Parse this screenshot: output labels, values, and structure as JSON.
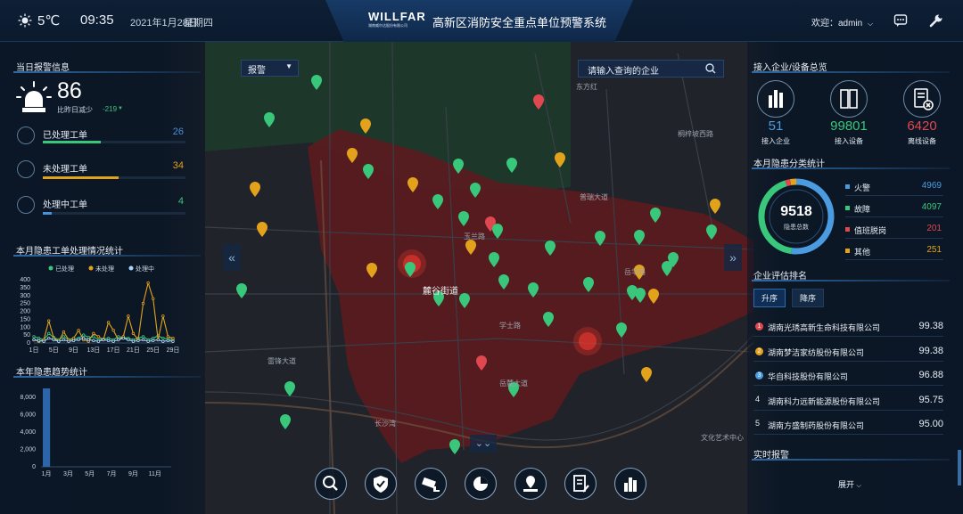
{
  "header": {
    "temperature": "5℃",
    "time": "09:35",
    "date": "2021年1月28日",
    "weekday": "星期四",
    "logo_text": "WILLFAR",
    "logo_subtext": "湖南威尔达股份有限公司",
    "title": "高新区消防安全重点单位预警系统",
    "welcome": "欢迎：admin",
    "icons": [
      "sun-icon",
      "chevron-down-icon",
      "message-icon",
      "wrench-icon"
    ]
  },
  "left": {
    "alarm_title": "当日报警信息",
    "alarm_count": "86",
    "alarm_compare_label": "比昨日减少",
    "alarm_compare_value": "-219",
    "orders": [
      {
        "label": "已处理工单",
        "value": "26",
        "color": "#4a90d9",
        "fill": 0.76
      },
      {
        "label": "未处理工单",
        "value": "34",
        "color": "#e3a21c",
        "fill": 0.58
      },
      {
        "label": "处理中工单",
        "value": "4",
        "color": "#38c77b",
        "fill": 0.05
      }
    ],
    "monthly_title": "本月隐患工单处理情况统计",
    "yearly_title": "本年隐患趋势统计"
  },
  "map": {
    "select_label": "报警",
    "search_placeholder": "请输入查询的企业",
    "district_label": "麓谷街道",
    "place_labels": [
      "雷锋大道",
      "东方红",
      "普瑞大道",
      "长沙湾",
      "岳麓大道",
      "文化艺术中心",
      "桐梓坡西路",
      "玉兰路",
      "学士路",
      "岳华路"
    ]
  },
  "right": {
    "overview_title": "接入企业/设备总览",
    "kpis": [
      {
        "value": "51",
        "label": "接入企业",
        "color": "#4a9be0",
        "icon": "enterprise-building-icon"
      },
      {
        "value": "99801",
        "label": "接入设备",
        "color": "#38c77b",
        "icon": "device-cabinet-icon"
      },
      {
        "value": "6420",
        "label": "离线设备",
        "color": "#e0484f",
        "icon": "offline-document-icon"
      }
    ],
    "hazard_title": "本月隐患分类统计",
    "hazard_total": "9518",
    "hazard_total_label": "隐患总数",
    "hazard_legend": [
      {
        "label": "火警",
        "value": "4969",
        "color": "#4a9be0"
      },
      {
        "label": "故障",
        "value": "4097",
        "color": "#38c77b"
      },
      {
        "label": "值班脱岗",
        "value": "201",
        "color": "#e0484f"
      },
      {
        "label": "其他",
        "value": "251",
        "color": "#e3a21c"
      }
    ],
    "ranking_title": "企业评估排名",
    "sort_asc": "升序",
    "sort_desc": "降序",
    "ranking": [
      {
        "index": "1",
        "name": "湖南光琇高新生命科技有限公司",
        "score": "99.38"
      },
      {
        "index": "2",
        "name": "湖南梦洁家纺股份有限公司",
        "score": "99.38"
      },
      {
        "index": "3",
        "name": "华自科技股份有限公司",
        "score": "96.88"
      },
      {
        "index": "4",
        "name": "湖南科力远新能源股份有限公司",
        "score": "95.75"
      },
      {
        "index": "5",
        "name": "湖南方盛制药股份有限公司",
        "score": "95.00"
      }
    ],
    "realtime_title": "实时报警",
    "expand_label": "展开"
  },
  "toolbar": [
    "magnifier-icon",
    "shield-check-icon",
    "camera-icon",
    "pie-chart-icon",
    "map-pin-icon",
    "report-edit-icon",
    "bar-building-icon"
  ],
  "chart_data": [
    {
      "type": "line",
      "title": "本月隐患工单处理情况统计",
      "x": [
        1,
        2,
        3,
        4,
        5,
        6,
        7,
        8,
        9,
        10,
        11,
        12,
        13,
        14,
        15,
        16,
        17,
        18,
        19,
        20,
        21,
        22,
        23,
        24,
        25,
        26,
        27,
        28,
        29
      ],
      "x_ticks": [
        "1日",
        "5日",
        "9日",
        "13日",
        "17日",
        "21日",
        "25日",
        "29日"
      ],
      "ylim": [
        0,
        400
      ],
      "y_ticks": [
        0,
        50,
        100,
        150,
        200,
        250,
        300,
        350,
        400
      ],
      "legend": "top",
      "series": [
        {
          "name": "已处理",
          "color": "#38c77b",
          "values": [
            40,
            30,
            20,
            60,
            35,
            20,
            40,
            20,
            25,
            30,
            50,
            35,
            40,
            20,
            25,
            30,
            20,
            40,
            35,
            30,
            20,
            30,
            40,
            20,
            30,
            45,
            30,
            25,
            20
          ]
        },
        {
          "name": "未处理",
          "color": "#e3a21c",
          "values": [
            20,
            10,
            20,
            140,
            30,
            10,
            70,
            20,
            30,
            80,
            20,
            10,
            60,
            40,
            20,
            130,
            80,
            20,
            40,
            170,
            60,
            20,
            250,
            380,
            280,
            20,
            170,
            40,
            30
          ]
        },
        {
          "name": "处理中",
          "color": "#a8d4f7",
          "values": [
            20,
            15,
            10,
            30,
            20,
            10,
            20,
            10,
            15,
            20,
            30,
            20,
            15,
            10,
            20,
            15,
            10,
            20,
            30,
            20,
            10,
            15,
            20,
            10,
            15,
            20,
            10,
            15,
            10
          ]
        }
      ]
    },
    {
      "type": "bar",
      "title": "本年隐患趋势统计",
      "categories": [
        "1月",
        "2月",
        "3月",
        "4月",
        "5月",
        "6月",
        "7月",
        "8月",
        "9月",
        "10月",
        "11月",
        "12月"
      ],
      "x_ticks": [
        "1月",
        "3月",
        "5月",
        "7月",
        "9月",
        "11月"
      ],
      "values": [
        9518,
        0,
        0,
        0,
        0,
        0,
        0,
        0,
        0,
        0,
        0,
        0
      ],
      "ylim": [
        0,
        9000
      ],
      "y_ticks": [
        "0",
        "2,000",
        "4,000",
        "6,000",
        "8,000"
      ],
      "color": "#2c66a8"
    },
    {
      "type": "pie",
      "title": "本月隐患分类统计",
      "categories": [
        "火警",
        "故障",
        "值班脱岗",
        "其他"
      ],
      "values": [
        4969,
        4097,
        201,
        251
      ]
    }
  ]
}
